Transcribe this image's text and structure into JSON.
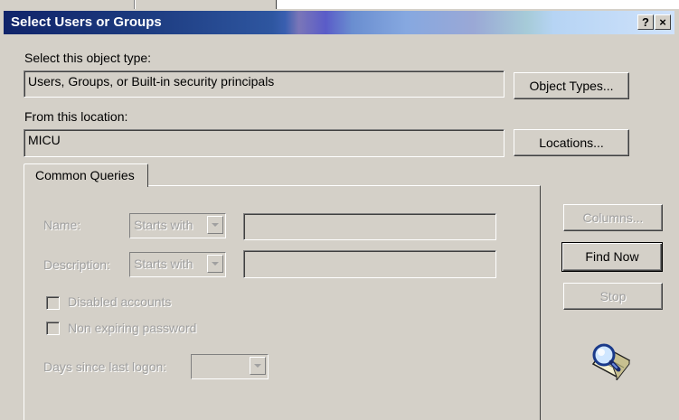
{
  "window": {
    "title": "Select Users or Groups",
    "help_label": "?",
    "close_label": "×"
  },
  "object_type": {
    "label": "Select this object type:",
    "value": "Users, Groups, or Built-in security principals",
    "button": "Object Types..."
  },
  "location": {
    "label": "From this location:",
    "value": "MICU",
    "button": "Locations..."
  },
  "tabs": [
    {
      "label": "Common Queries"
    }
  ],
  "queries": {
    "name_label": "Name:",
    "name_mode": "Starts with",
    "description_label": "Description:",
    "description_mode": "Starts with",
    "disabled_accounts": "Disabled accounts",
    "non_expiring_password": "Non expiring password",
    "days_label": "Days since last logon:"
  },
  "side_buttons": {
    "columns": "Columns...",
    "find_now": "Find Now",
    "stop": "Stop"
  },
  "icons": {
    "search_animation": "magnifier-search-icon"
  }
}
